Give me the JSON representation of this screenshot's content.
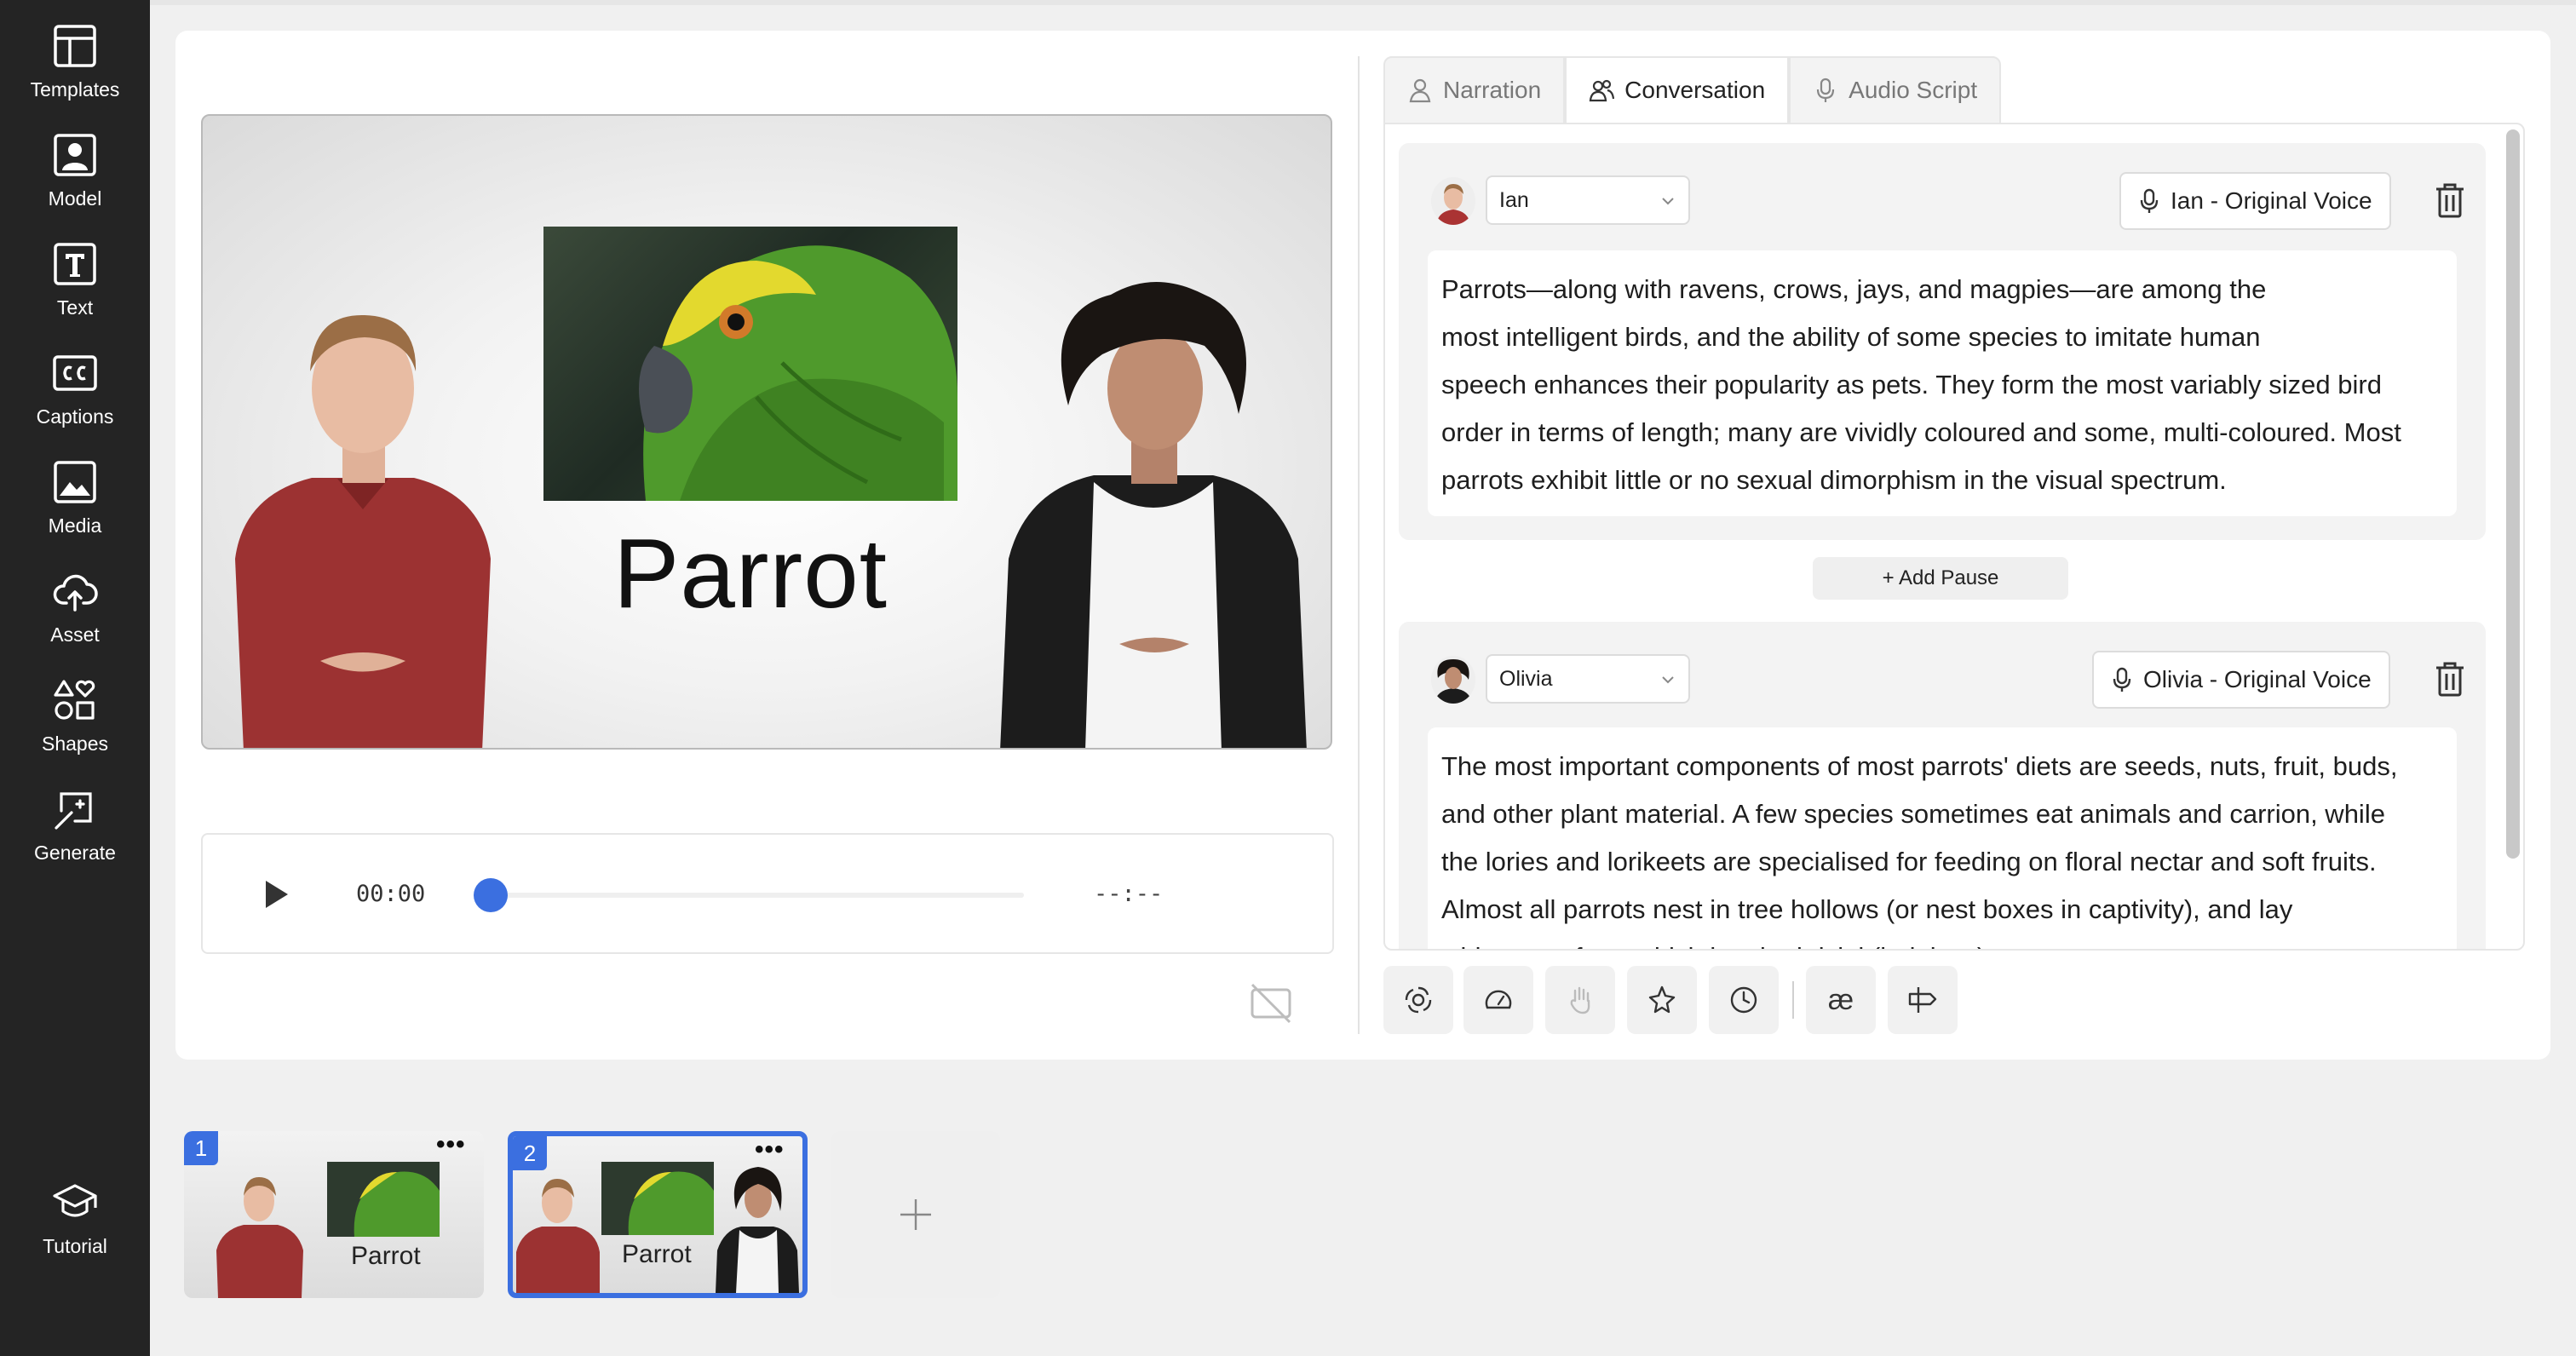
{
  "sidebar": {
    "items": [
      {
        "label": "Templates",
        "icon": "layout-icon"
      },
      {
        "label": "Model",
        "icon": "person-square-icon"
      },
      {
        "label": "Text",
        "icon": "text-icon"
      },
      {
        "label": "Captions",
        "icon": "cc-icon"
      },
      {
        "label": "Media",
        "icon": "image-icon"
      },
      {
        "label": "Asset",
        "icon": "cloud-upload-icon"
      },
      {
        "label": "Shapes",
        "icon": "shapes-icon"
      },
      {
        "label": "Generate",
        "icon": "magic-generate-icon"
      }
    ],
    "tutorial": {
      "label": "Tutorial",
      "icon": "graduation-cap-icon"
    }
  },
  "preview": {
    "slide_title": "Parrot"
  },
  "player": {
    "current_time": "00:00",
    "end_time": "--:--",
    "progress": 0
  },
  "tabs": [
    {
      "label": "Narration",
      "icon": "person-icon",
      "active": false
    },
    {
      "label": "Conversation",
      "icon": "people-icon",
      "active": true
    },
    {
      "label": "Audio Script",
      "icon": "microphone-icon",
      "active": false
    }
  ],
  "conversation": {
    "blocks": [
      {
        "speaker": "Ian",
        "voice": "Ian - Original Voice",
        "lines": [
          "Parrots—along with ravens, crows, jays, and magpies—are among the",
          "most intelligent birds, and the ability of some species to imitate human",
          "speech enhances their popularity as pets. They form the most variably sized bird",
          "order in terms of length; many are vividly coloured and some, multi-coloured. Most",
          "parrots exhibit little or no sexual dimorphism in the visual spectrum."
        ]
      },
      {
        "speaker": "Olivia",
        "voice": "Olivia - Original Voice",
        "lines": [
          "The most important components of most parrots' diets are seeds, nuts, fruit, buds,",
          "and other plant material. A few species sometimes eat animals and carrion, while",
          "the lories and lorikeets are specialised for feeding on floral nectar and soft fruits.",
          "Almost all parrots nest in tree hollows (or nest boxes in captivity), and lay",
          "white eggs from which hatch altricial (helpless) young."
        ]
      }
    ],
    "add_pause_label": "+ Add Pause"
  },
  "toolbar": {
    "tools": [
      "openai-icon",
      "speed-gauge-icon",
      "gesture-hand-icon",
      "magic-pin-icon",
      "clock-icon",
      "ipa-ae-icon",
      "sign-pointer-icon"
    ],
    "ipa_glyph": "æ"
  },
  "slides": [
    {
      "number": "1",
      "title": "Parrot",
      "selected": false
    },
    {
      "number": "2",
      "title": "Parrot",
      "selected": true
    }
  ],
  "add_slide": {
    "icon": "plus-icon"
  },
  "colors": {
    "accent": "#3b6fe0",
    "sidebar": "#242424"
  }
}
